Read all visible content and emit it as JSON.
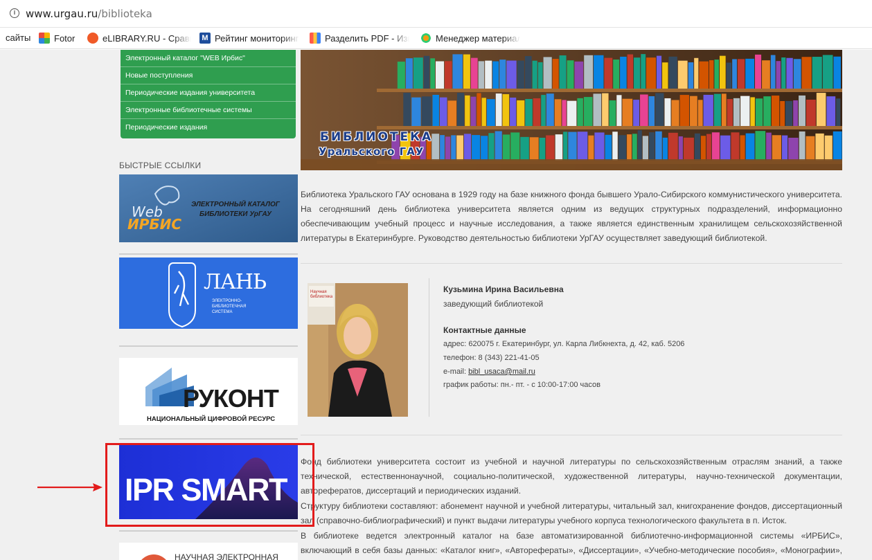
{
  "browser": {
    "url_host": "www.urgau.ru",
    "url_path": "/biblioteka",
    "bookmarks": [
      {
        "label": "сайты",
        "icon": "none"
      },
      {
        "label": "Fotor",
        "icon": "fotor-icon"
      },
      {
        "label": "eLIBRARY.RU - Сравн",
        "icon": "elibrary-icon"
      },
      {
        "label": "Рейтинг мониторинг",
        "icon": "monitoring-icon"
      },
      {
        "label": "Разделить PDF - Изв",
        "icon": "pdf-icon"
      },
      {
        "label": "Менеджер материал",
        "icon": "manager-icon"
      }
    ]
  },
  "sidebar": {
    "menu": [
      "Электронный каталог \"WEB Ирбис\"",
      "Новые поступления",
      "Периодические издания университета",
      "Электронные библиотечные системы",
      "Периодические издания"
    ],
    "quick_links_title": "БЫСТРЫЕ ССЫЛКИ",
    "irbis": {
      "web": "Web",
      "name": "ИРБИС",
      "line1": "ЭЛЕКТРОННЫЙ КАТАЛОГ",
      "line2": "БИБЛИОТЕКИ УрГАУ"
    },
    "lan": {
      "name": "ЛАНЬ",
      "line1": "ЭЛЕКТРОННО-",
      "line2": "БИБЛИОТЕЧНАЯ",
      "line3": "СИСТЕМА"
    },
    "rukont": {
      "name": "РУКОНТ",
      "sub": "НАЦИОНАЛЬНЫЙ ЦИФРОВОЙ РЕСУРС"
    },
    "ipr": {
      "name": "IPR SMART"
    },
    "next": {
      "label": "НАУЧНАЯ ЭЛЕКТРОННАЯ"
    }
  },
  "banner": {
    "line1": "БИБЛИОТЕКА",
    "line2": "Уральского ГАУ"
  },
  "content": {
    "intro": "Библиотека Уральского ГАУ основана в 1929 году на базе книжного фонда бывшего Урало-Сибирского коммунистического университета. На сегодняшний день библиотека университета является одним из ведущих структурных подразделений, информационно обеспечивающим учебный процесс и научные исследования, а также является единственным хранилищем сельскохозяйственной литературы в Екатеринбурге. Руководство деятельностью библиотеки УрГАУ осуществляет заведующий библиотекой.",
    "photo_sign": "Научная библиотека",
    "person": {
      "name": "Кузьмина Ирина Васильевна",
      "position": "заведующий библиотекой",
      "contacts_title": "Контактные данные",
      "address": "адрес: 620075 г. Екатеринбург, ул. Карла Либкнехта, д. 42, каб. 5206",
      "phone": "телефон: 8 (343) 221-41-05",
      "email_label": "e-mail: ",
      "email": "bibl_usaca@mail.ru",
      "schedule": "график работы: пн.- пт. - с 10:00-17:00 часов"
    },
    "para2": "Фонд библиотеки университета состоит из учебной и научной литературы по сельскохозяйственным отраслям знаний, а также технической, естественнонаучной, социально-политической, художественной литературы, научно-технической документации, авторефератов, диссертаций и периодических изданий.",
    "para3": "Структуру библиотеки составляют: абонемент научной и учебной литературы, читальный зал, книгохранение фондов, диссертационный зал (справочно-библиографический) и пункт выдачи литературы учебного корпуса технологического факультета в п. Исток.",
    "para4": "В библиотеке ведется электронный каталог на базе автоматизированной библиотечно-информационной системы «ИРБИС», включающий в себя базы данных: «Каталог книг», «Авторефераты», «Диссертации», «Учебно-методические пособия», «Монографии», «Выпускные"
  },
  "colors": {
    "menu_green": "#2f9e4f",
    "highlight_red": "#e21b1b",
    "ipr_blue": "#2331d6"
  }
}
